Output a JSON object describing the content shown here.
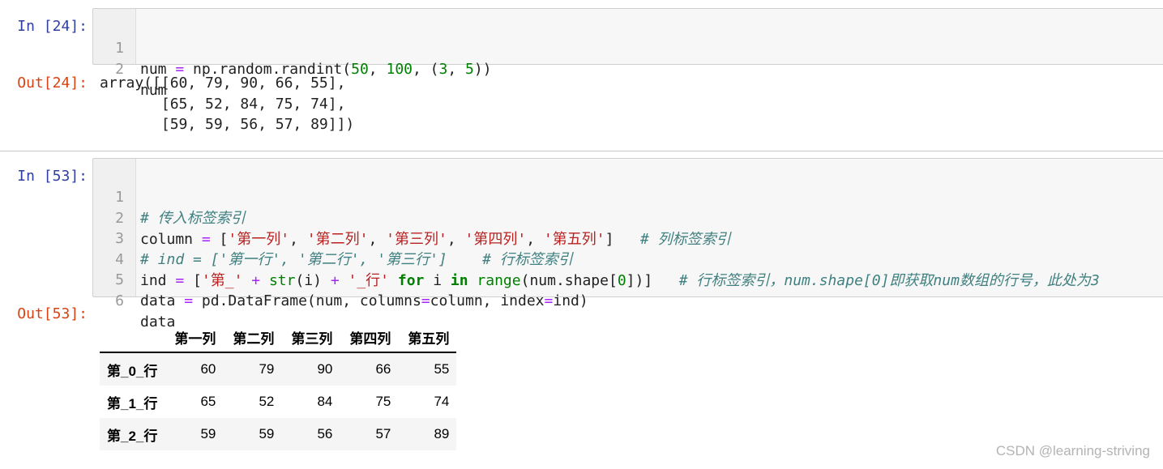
{
  "cells": [
    {
      "in_prompt": "In  [24]:",
      "code_lines": [
        {
          "n": "1"
        },
        {
          "n": "2",
          "text": "num"
        }
      ],
      "code_tokens_line1": [
        "num ",
        "=",
        " np.random.randint(",
        "50",
        ", ",
        "100",
        ", (",
        "3",
        ", ",
        "5",
        "))"
      ],
      "out_prompt": "Out[24]:",
      "output_lines": [
        "array([[60, 79, 90, 66, 55],",
        "       [65, 52, 84, 75, 74],",
        "       [59, 59, 56, 57, 89]])"
      ]
    },
    {
      "in_prompt": "In  [53]:",
      "line_numbers": [
        "1",
        "2",
        "3",
        "4",
        "5",
        "6"
      ],
      "l1_comment": "# 传入标签索引",
      "l2": [
        "column ",
        "=",
        " [",
        "'第一列'",
        ", ",
        "'第二列'",
        ", ",
        "'第三列'",
        ", ",
        "'第四列'",
        ", ",
        "'第五列'",
        "]   ",
        "# 列标签索引"
      ],
      "l3_comment": "# ind = ['第一行', '第二行', '第三行']    # 行标签索引",
      "l4": [
        "ind ",
        "=",
        " [",
        "'第_'",
        " ",
        "+",
        " ",
        "str",
        "(i) ",
        "+",
        " ",
        "'_行'",
        " ",
        "for",
        " i ",
        "in",
        " ",
        "range",
        "(num.shape[",
        "0",
        "])]   ",
        "# 行标签索引，num.shape[0]即获取num数组的行号，此处为3"
      ],
      "l5": [
        "data ",
        "=",
        " pd.DataFrame(num, columns",
        "=",
        "column, index",
        "=",
        "ind)"
      ],
      "l6": "data",
      "out_prompt": "Out[53]:",
      "table": {
        "columns": [
          "第一列",
          "第二列",
          "第三列",
          "第四列",
          "第五列"
        ],
        "rows": [
          {
            "index": "第_0_行",
            "values": [
              "60",
              "79",
              "90",
              "66",
              "55"
            ]
          },
          {
            "index": "第_1_行",
            "values": [
              "65",
              "52",
              "84",
              "75",
              "74"
            ]
          },
          {
            "index": "第_2_行",
            "values": [
              "59",
              "59",
              "56",
              "57",
              "89"
            ]
          }
        ]
      }
    }
  ],
  "watermark": "CSDN @learning-striving",
  "colors": {
    "in_prompt": "#303F9F",
    "out_prompt": "#D84315",
    "keyword": "#008000",
    "operator": "#AA22FF",
    "string": "#BA2121",
    "comment": "#408080"
  }
}
